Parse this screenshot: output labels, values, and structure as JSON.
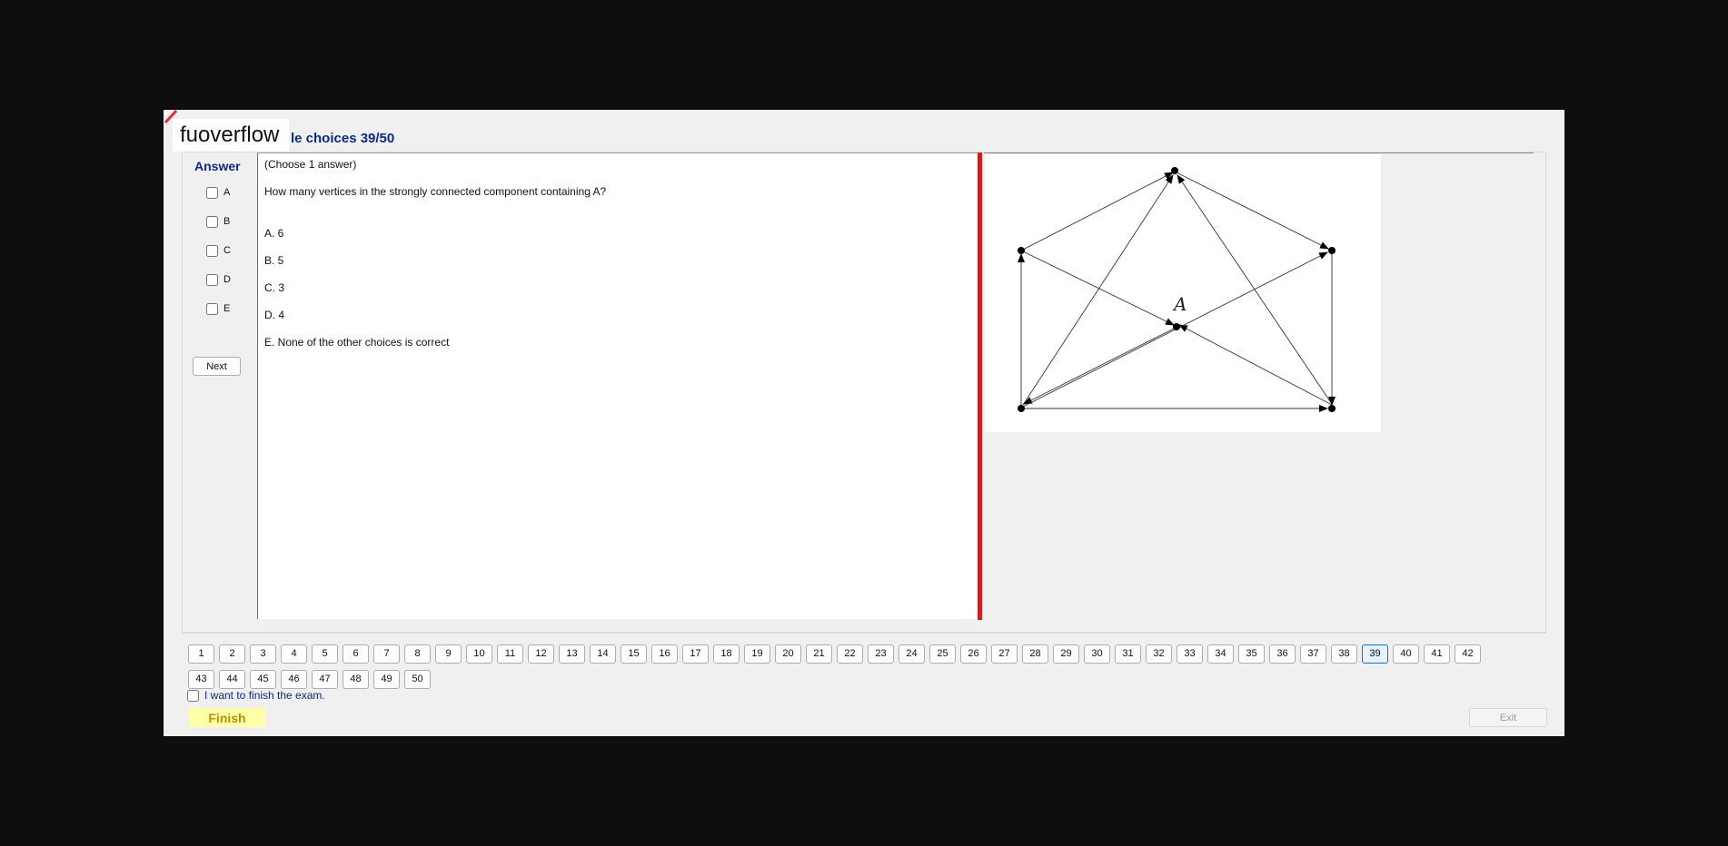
{
  "app": {
    "logo_text": "fuoverflow",
    "title": "le choices 39/50"
  },
  "answer": {
    "label": "Answer",
    "options": [
      "A",
      "B",
      "C",
      "D",
      "E"
    ],
    "next_label": "Next"
  },
  "question": {
    "instruction": "(Choose 1 answer)",
    "text": "How many vertices in the strongly connected component containing A?",
    "choices": [
      "A.  6",
      "B.  5",
      "C.  3",
      "D.  4",
      "E.  None of the other choices is correct"
    ]
  },
  "figure": {
    "vertex_label": "A"
  },
  "navigation": {
    "question_numbers": [
      "1",
      "2",
      "3",
      "4",
      "5",
      "6",
      "7",
      "8",
      "9",
      "10",
      "11",
      "12",
      "13",
      "14",
      "15",
      "16",
      "17",
      "18",
      "19",
      "20",
      "21",
      "22",
      "23",
      "24",
      "25",
      "26",
      "27",
      "28",
      "29",
      "30",
      "31",
      "32",
      "33",
      "34",
      "35",
      "36",
      "37",
      "38",
      "39",
      "40",
      "41",
      "42",
      "43",
      "44",
      "45",
      "46",
      "47",
      "48",
      "49",
      "50"
    ],
    "current": "39"
  },
  "footer": {
    "finish_checkbox_label": "I want to finish the exam.",
    "finish_label": "Finish",
    "exit_label": "Exit"
  },
  "colors": {
    "title_blue": "#0a2a8a",
    "divider_red": "#cc1f1f",
    "finish_bg": "#ffffa8",
    "active_question": "#0078d7"
  }
}
